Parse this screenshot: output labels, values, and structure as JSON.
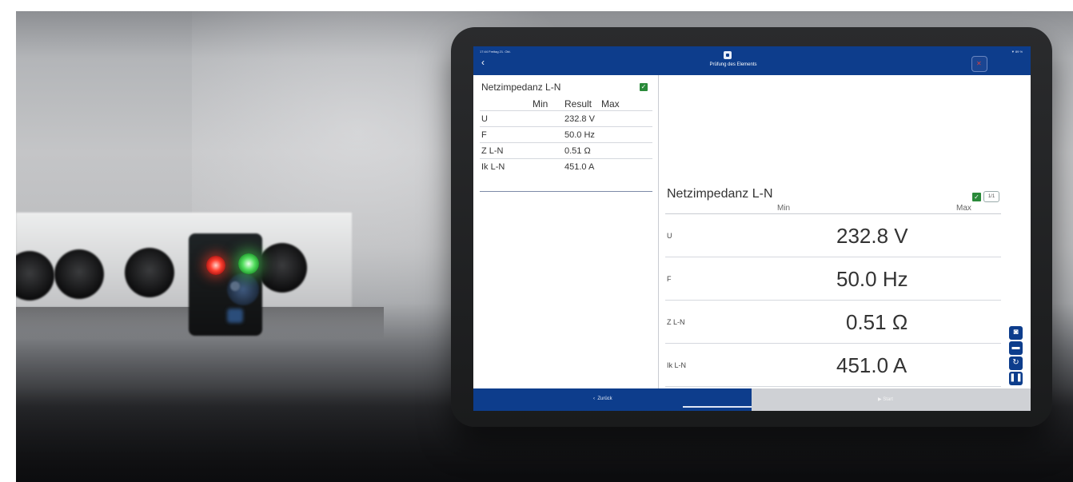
{
  "status_bar": {
    "time": "17:44  Freitag 21. Okt.",
    "right": "▼ 89 %"
  },
  "top_bar": {
    "title": "Prüfung des Elements",
    "close_icon": "close-x-icon",
    "back_icon": "chevron-left-icon"
  },
  "left_card": {
    "title": "Netzimpedanz L-N",
    "headers": {
      "min": "Min",
      "result": "Result",
      "max": "Max"
    },
    "rows": [
      {
        "label": "U",
        "value": "232.8 V"
      },
      {
        "label": "F",
        "value": "50.0 Hz"
      },
      {
        "label": "Z L-N",
        "value": "0.51 Ω"
      },
      {
        "label": "Ik L-N",
        "value": "451.0 A"
      }
    ]
  },
  "detail": {
    "title": "Netzimpedanz L-N",
    "page": "1/1",
    "min": "Min",
    "max": "Max",
    "rows": [
      {
        "label": "U",
        "value": "232.8 V"
      },
      {
        "label": "F",
        "value": "50.0 Hz"
      },
      {
        "label": "Z L-N",
        "value": "0.51 Ω"
      },
      {
        "label": "Ik L-N",
        "value": "451.0 A"
      }
    ]
  },
  "tools": [
    "camera-icon",
    "folder-icon",
    "refresh-icon",
    "pause-icon"
  ],
  "bottom_bar": {
    "back_label": "Zurück",
    "next_label": "▶  Start"
  },
  "colors": {
    "brand_blue": "#0d3d8c",
    "check_green": "#2a8a3a",
    "led_red": "#ff4030",
    "led_green": "#55e060"
  }
}
